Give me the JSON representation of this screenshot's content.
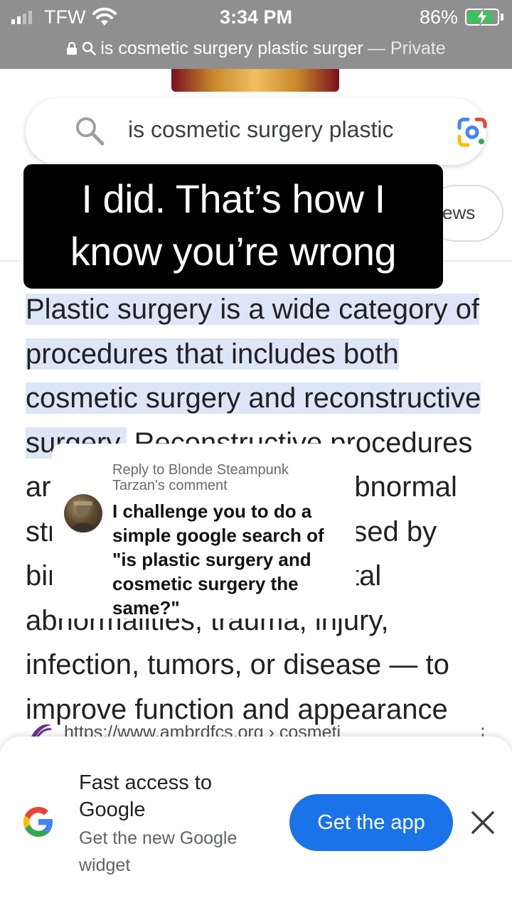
{
  "status_bar": {
    "carrier": "TFW",
    "time": "3:34 PM",
    "battery_percent": "86%",
    "battery_level": 0.86
  },
  "url_bar": {
    "url_text": "is cosmetic surgery plastic surger",
    "mode": "— Private"
  },
  "search": {
    "query": "is cosmetic surgery plastic"
  },
  "tabs": {
    "news_partial": "ews"
  },
  "caption": {
    "line1": "I did. That’s how I",
    "line2": "know you’re wrong"
  },
  "snippet": {
    "highlighted": "Plastic surgery is a wide category of procedures that includes both cosmetic surgery and reconstructive surgery.",
    "rest": " Reconstructive procedures are performed to correct abnormal structures of the body caused by birth defects, developmental abnormalities, trauma, injury, infection, tumors, or disease — to improve function and appearance after an injury, illness, or congenital problem."
  },
  "citation": {
    "url": "https://www.ambrdfcs.org › cosmeti",
    "menu": "⋮"
  },
  "reply_sticker": {
    "reply_to": "Reply to Blonde Steampunk Tarzan's comment",
    "comment": "I challenge you to do a simple google search of \"is plastic surgery and cosmetic surgery the same?\""
  },
  "banner": {
    "title": "Fast access to Google",
    "subtitle": "Get the new Google widget",
    "button_label": "Get the app",
    "close_glyph": "✕"
  },
  "colors": {
    "accent": "#1a73e8",
    "highlight": "#dde6f7",
    "status_bg": "#8f8f8f",
    "battery": "#34c759"
  }
}
